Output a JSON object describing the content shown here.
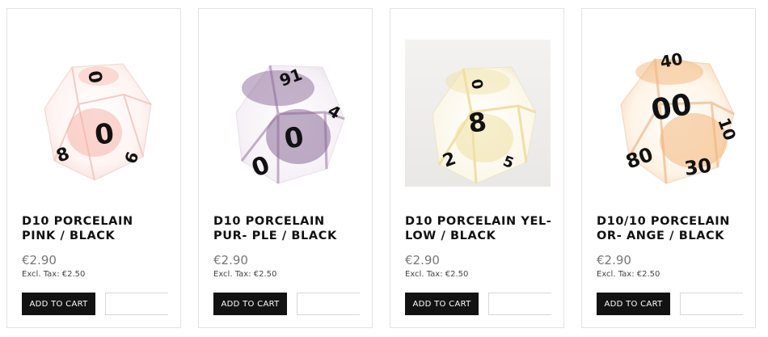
{
  "products": [
    {
      "title": "D10 PORCELAIN PINK / BLACK",
      "price": "€2.90",
      "tax": "Excl. Tax: €2.50",
      "cart_label": "ADD TO CART",
      "tint": "#f3b5a6"
    },
    {
      "title": "D10 PORCELAIN PUR- PLE / BLACK",
      "price": "€2.90",
      "tax": "Excl. Tax: €2.50",
      "cart_label": "ADD TO CART",
      "tint": "#9a7aa6"
    },
    {
      "title": "D10 PORCELAIN YEL- LOW / BLACK",
      "price": "€2.90",
      "tax": "Excl. Tax: €2.50",
      "cart_label": "ADD TO CART",
      "tint": "#f0e1a2"
    },
    {
      "title": "D10/10 PORCELAIN OR- ANGE / BLACK",
      "price": "€2.90",
      "tax": "Excl. Tax: €2.50",
      "cart_label": "ADD TO CART",
      "tint": "#f2c48f"
    }
  ]
}
